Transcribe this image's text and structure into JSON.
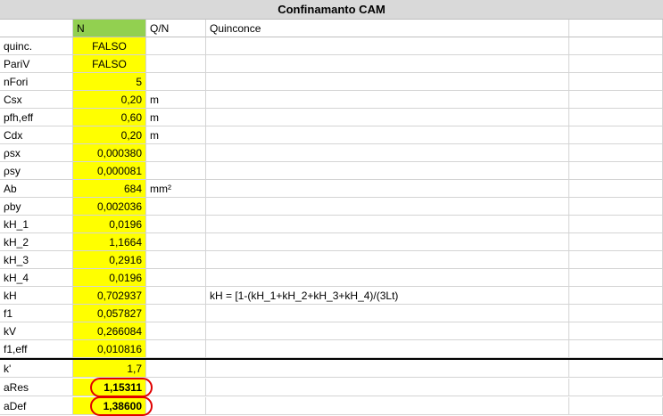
{
  "title": "Confinamanto CAM",
  "header": {
    "col_n": "N",
    "col_qn": "Q/N",
    "col_desc": "Quinconce"
  },
  "rows": [
    {
      "label": "quinc.",
      "value": "FALSO",
      "unit": "",
      "note": "",
      "align": "center"
    },
    {
      "label": "PariV",
      "value": "FALSO",
      "unit": "",
      "note": "",
      "align": "center"
    },
    {
      "label": "nFori",
      "value": "5",
      "unit": "",
      "note": ""
    },
    {
      "label": "Csx",
      "value": "0,20",
      "unit": "m",
      "note": ""
    },
    {
      "label": "pfh,eff",
      "value": "0,60",
      "unit": "m",
      "note": ""
    },
    {
      "label": "Cdx",
      "value": "0,20",
      "unit": "m",
      "note": ""
    },
    {
      "label": "ρsx",
      "value": "0,000380",
      "unit": "",
      "note": ""
    },
    {
      "label": "ρsy",
      "value": "0,000081",
      "unit": "",
      "note": ""
    },
    {
      "label": "Ab",
      "value": "684",
      "unit": "mm²",
      "note": ""
    },
    {
      "label": "ρby",
      "value": "0,002036",
      "unit": "",
      "note": ""
    },
    {
      "label": "kH_1",
      "value": "0,0196",
      "unit": "",
      "note": ""
    },
    {
      "label": "kH_2",
      "value": "1,1664",
      "unit": "",
      "note": ""
    },
    {
      "label": "kH_3",
      "value": "0,2916",
      "unit": "",
      "note": ""
    },
    {
      "label": "kH_4",
      "value": "0,0196",
      "unit": "",
      "note": ""
    },
    {
      "label": "kH",
      "value": "0,702937",
      "unit": "",
      "note": "kH = [1-(kH_1+kH_2+kH_3+kH_4)/(3Lt)"
    },
    {
      "label": "f1",
      "value": "0,057827",
      "unit": "",
      "note": ""
    },
    {
      "label": "kV",
      "value": "0,266084",
      "unit": "",
      "note": ""
    },
    {
      "label": "f1,eff",
      "value": "0,010816",
      "unit": "",
      "note": ""
    }
  ],
  "rows_lower": [
    {
      "label": "k'",
      "value": "1,7"
    },
    {
      "label": "aRes",
      "value": "1,15311"
    },
    {
      "label": "aDef",
      "value": "1,38600"
    }
  ],
  "highlight_color": "#ffff00",
  "header_color": "#92d050",
  "circle_color": "#e00000"
}
